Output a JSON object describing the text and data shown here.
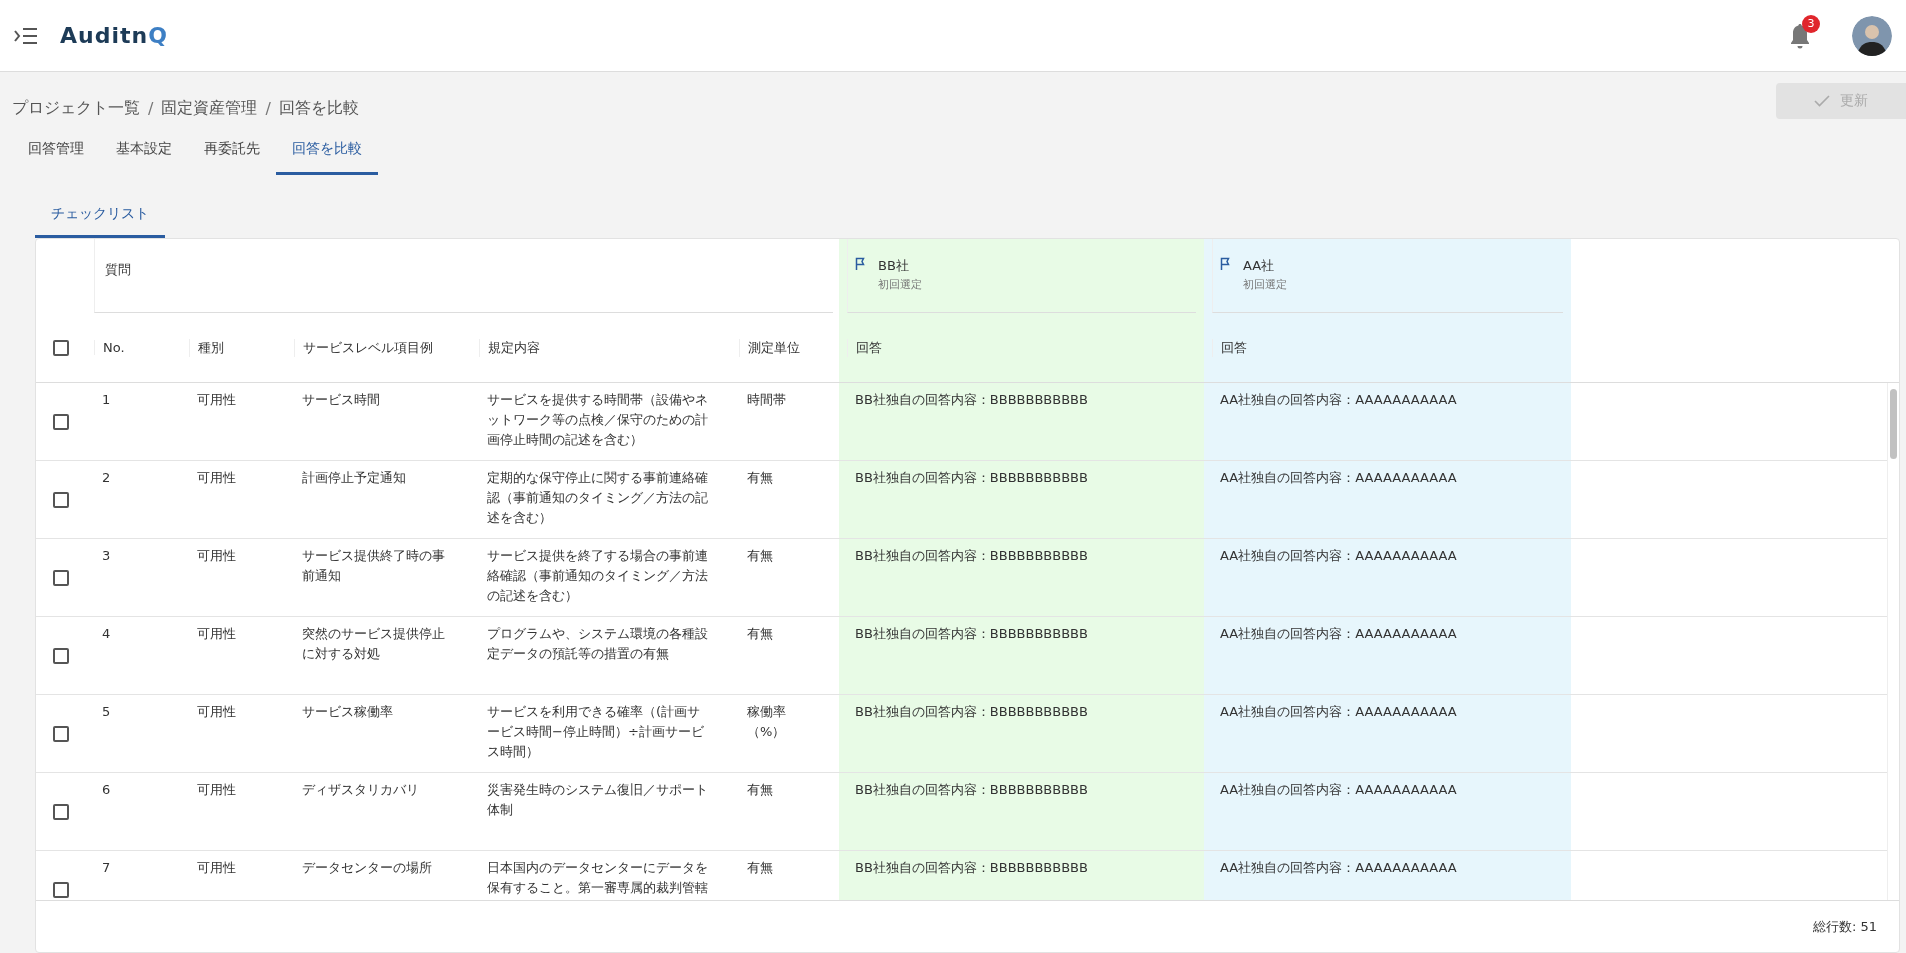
{
  "app": {
    "logo_main": "Auditn",
    "logo_accent": "Q",
    "notification_count": "3"
  },
  "breadcrumb": [
    {
      "kind": "link",
      "label": "プロジェクト一覧"
    },
    {
      "kind": "separator",
      "label": "/"
    },
    {
      "kind": "link",
      "label": "固定資産管理"
    },
    {
      "kind": "separator",
      "label": "/"
    },
    {
      "kind": "current",
      "label": "回答を比較"
    }
  ],
  "update_button": {
    "label": "更新",
    "disabled": true
  },
  "tabs": [
    {
      "label": "回答管理",
      "selected": false
    },
    {
      "label": "基本設定",
      "selected": false
    },
    {
      "label": "再委託先",
      "selected": false
    },
    {
      "label": "回答を比較",
      "selected": true
    }
  ],
  "subtabs": [
    {
      "label": "チェックリスト",
      "selected": true
    }
  ],
  "table": {
    "question_group": "質問",
    "select_all": {
      "checked": false
    },
    "columns": [
      "No.",
      "種別",
      "サービスレベル項目例",
      "規定内容",
      "測定単位"
    ],
    "companies": [
      {
        "name": "BB社",
        "note": "初回選定",
        "answer_header": "回答",
        "color": "#e8fbe6"
      },
      {
        "name": "AA社",
        "note": "初回選定",
        "answer_header": "回答",
        "color": "#e7f6fc"
      }
    ],
    "rows": [
      {
        "checked": false,
        "cells": [
          "1",
          "可用性",
          "サービス時間",
          "サービスを提供する時間帯（設備やネットワーク等の点検／保守のための計画停止時間の記述を含む）",
          "時間帯"
        ],
        "answers": [
          "BB社独自の回答内容：BBBBBBBBBBB",
          "AA社独自の回答内容：AAAAAAAAAAA"
        ]
      },
      {
        "checked": false,
        "cells": [
          "2",
          "可用性",
          "計画停止予定通知",
          "定期的な保守停止に関する事前連絡確認（事前通知のタイミング／方法の記述を含む）",
          "有無"
        ],
        "answers": [
          "BB社独自の回答内容：BBBBBBBBBBB",
          "AA社独自の回答内容：AAAAAAAAAAA"
        ]
      },
      {
        "checked": false,
        "cells": [
          "3",
          "可用性",
          "サービス提供終了時の事前通知",
          "サービス提供を終了する場合の事前連絡確認（事前通知のタイミング／方法の記述を含む）",
          "有無"
        ],
        "answers": [
          "BB社独自の回答内容：BBBBBBBBBBB",
          "AA社独自の回答内容：AAAAAAAAAAA"
        ]
      },
      {
        "checked": false,
        "cells": [
          "4",
          "可用性",
          "突然のサービス提供停止に対する対処",
          "プログラムや、システム環境の各種設定データの預託等の措置の有無",
          "有無"
        ],
        "answers": [
          "BB社独自の回答内容：BBBBBBBBBBB",
          "AA社独自の回答内容：AAAAAAAAAAA"
        ]
      },
      {
        "checked": false,
        "cells": [
          "5",
          "可用性",
          "サービス稼働率",
          "サービスを利用できる確率（(計画サービス時間−停止時間）÷計画サービス時間）",
          "稼働率（%）"
        ],
        "answers": [
          "BB社独自の回答内容：BBBBBBBBBBB",
          "AA社独自の回答内容：AAAAAAAAAAA"
        ]
      },
      {
        "checked": false,
        "cells": [
          "6",
          "可用性",
          "ディザスタリカバリ",
          "災害発生時のシステム復旧／サポート体制",
          "有無"
        ],
        "answers": [
          "BB社独自の回答内容：BBBBBBBBBBB",
          "AA社独自の回答内容：AAAAAAAAAAA"
        ]
      },
      {
        "checked": false,
        "cells": [
          "7",
          "可用性",
          "データセンターの場所",
          "日本国内のデータセンターにデータを保有すること。第一審専属的裁判管轄",
          "有無"
        ],
        "answers": [
          "BB社独自の回答内容：BBBBBBBBBBB",
          "AA社独自の回答内容：AAAAAAAAAAA"
        ]
      }
    ],
    "total": "総行数: 51"
  }
}
